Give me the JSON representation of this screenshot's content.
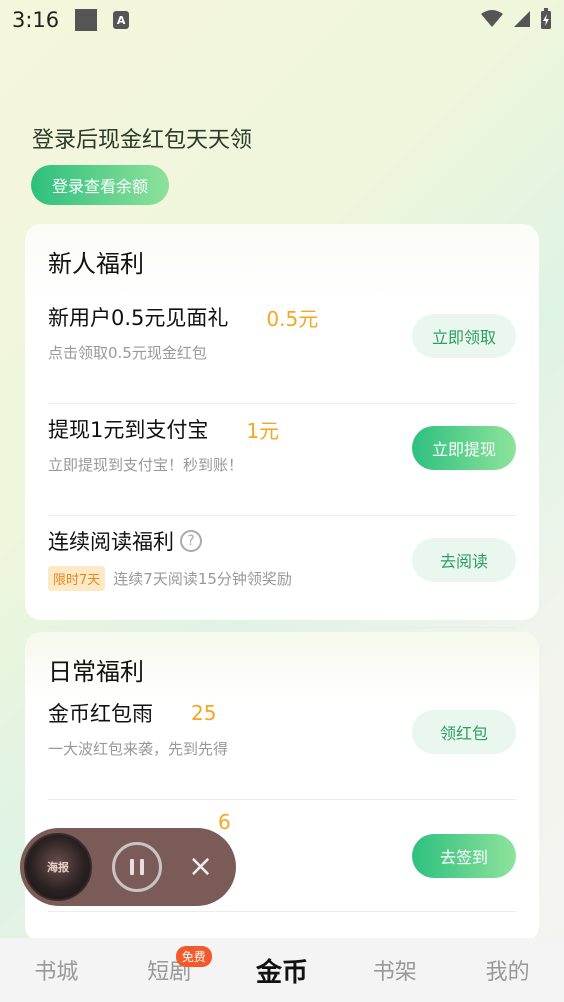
{
  "status": {
    "time": "3:16",
    "a_label": "A"
  },
  "hero": {
    "title": "登录后现金红包天天领",
    "login_button": "登录查看余额"
  },
  "newbie": {
    "title": "新人福利",
    "items": [
      {
        "title": "新用户0.5元见面礼",
        "amount": "0.5元",
        "subtitle": "点击领取0.5元现金红包",
        "button": "立即领取"
      },
      {
        "title": "提现1元到支付宝",
        "amount": "1元",
        "subtitle": "立即提现到支付宝！秒到账！",
        "button": "立即提现"
      },
      {
        "title": "连续阅读福利",
        "badge": "限时7天",
        "subtitle": "连续7天阅读15分钟领奖励",
        "button": "去阅读",
        "help": "?"
      }
    ]
  },
  "daily": {
    "title": "日常福利",
    "items": [
      {
        "title": "金币红包雨",
        "amount": "25",
        "subtitle": "一大波红包来袭，先到先得",
        "button": "领红包"
      },
      {
        "amount_partial": "6",
        "button": "去签到"
      }
    ]
  },
  "player": {
    "cover_text": "海报",
    "close": "×"
  },
  "nav": {
    "items": [
      "书城",
      "短剧",
      "金币",
      "书架",
      "我的"
    ],
    "badge": "免费",
    "active_index": 2
  },
  "colors": {
    "accent_green": "#2ec07f",
    "amount_orange": "#f5a623"
  }
}
